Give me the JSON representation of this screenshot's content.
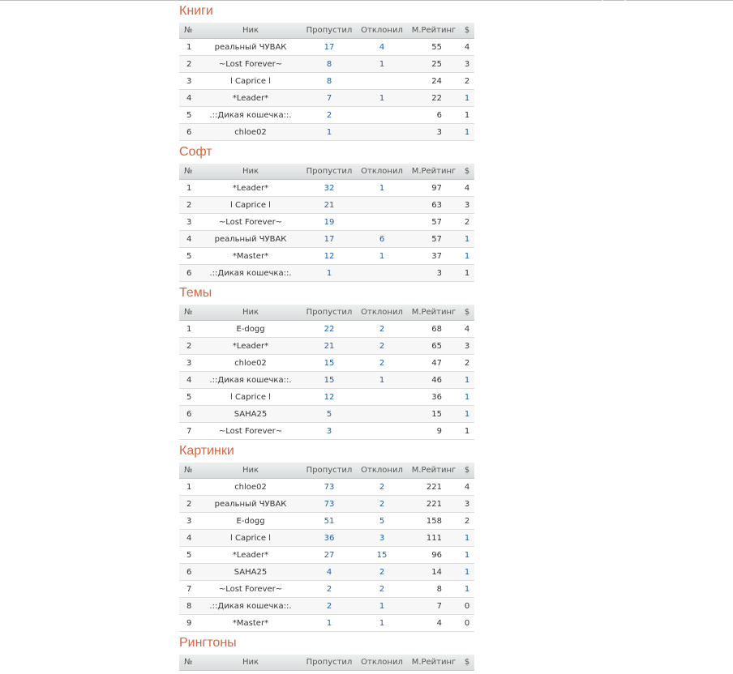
{
  "headers": {
    "num": "№",
    "nick": "Ник",
    "skipped": "Пропустил",
    "rejected": "Отклонил",
    "rating": "М.Рейтинг",
    "cash": "$"
  },
  "sections": [
    {
      "title": "Книги",
      "rows": [
        {
          "num": "1",
          "nick": "реальный ЧУВАК",
          "skipped": "17",
          "rejected": "4",
          "rating": "55",
          "cash": "4",
          "cash_link": false
        },
        {
          "num": "2",
          "nick": "~Lost Forever~",
          "skipped": "8",
          "rejected": "1",
          "rating": "25",
          "cash": "3",
          "cash_link": false
        },
        {
          "num": "3",
          "nick": "l Caprice l",
          "skipped": "8",
          "rejected": "",
          "rating": "24",
          "cash": "2",
          "cash_link": false
        },
        {
          "num": "4",
          "nick": "*Leader*",
          "skipped": "7",
          "rejected": "1",
          "rating": "22",
          "cash": "1",
          "cash_link": true
        },
        {
          "num": "5",
          "nick": ".::Дикая кошечка::.",
          "skipped": "2",
          "rejected": "",
          "rating": "6",
          "cash": "1",
          "cash_link": false
        },
        {
          "num": "6",
          "nick": "chloe02",
          "skipped": "1",
          "rejected": "",
          "rating": "3",
          "cash": "1",
          "cash_link": true
        }
      ]
    },
    {
      "title": "Софт",
      "rows": [
        {
          "num": "1",
          "nick": "*Leader*",
          "skipped": "32",
          "rejected": "1",
          "rating": "97",
          "cash": "4",
          "cash_link": false
        },
        {
          "num": "2",
          "nick": "l Caprice l",
          "skipped": "21",
          "rejected": "",
          "rating": "63",
          "cash": "3",
          "cash_link": false
        },
        {
          "num": "3",
          "nick": "~Lost Forever~",
          "skipped": "19",
          "rejected": "",
          "rating": "57",
          "cash": "2",
          "cash_link": false
        },
        {
          "num": "4",
          "nick": "реальный ЧУВАК",
          "skipped": "17",
          "rejected": "6",
          "rating": "57",
          "cash": "1",
          "cash_link": true
        },
        {
          "num": "5",
          "nick": "*Master*",
          "skipped": "12",
          "rejected": "1",
          "rating": "37",
          "cash": "1",
          "cash_link": true
        },
        {
          "num": "6",
          "nick": ".::Дикая кошечка::.",
          "skipped": "1",
          "rejected": "",
          "rating": "3",
          "cash": "1",
          "cash_link": false
        }
      ]
    },
    {
      "title": "Темы",
      "rows": [
        {
          "num": "1",
          "nick": "E-dogg",
          "skipped": "22",
          "rejected": "2",
          "rating": "68",
          "cash": "4",
          "cash_link": false
        },
        {
          "num": "2",
          "nick": "*Leader*",
          "skipped": "21",
          "rejected": "2",
          "rating": "65",
          "cash": "3",
          "cash_link": false
        },
        {
          "num": "3",
          "nick": "chloe02",
          "skipped": "15",
          "rejected": "2",
          "rating": "47",
          "cash": "2",
          "cash_link": false
        },
        {
          "num": "4",
          "nick": ".::Дикая кошечка::.",
          "skipped": "15",
          "rejected": "1",
          "rating": "46",
          "cash": "1",
          "cash_link": true
        },
        {
          "num": "5",
          "nick": "l Caprice l",
          "skipped": "12",
          "rejected": "",
          "rating": "36",
          "cash": "1",
          "cash_link": true
        },
        {
          "num": "6",
          "nick": "SAHA25",
          "skipped": "5",
          "rejected": "",
          "rating": "15",
          "cash": "1",
          "cash_link": true
        },
        {
          "num": "7",
          "nick": "~Lost Forever~",
          "skipped": "3",
          "rejected": "",
          "rating": "9",
          "cash": "1",
          "cash_link": false
        }
      ]
    },
    {
      "title": "Картинки",
      "rows": [
        {
          "num": "1",
          "nick": "chloe02",
          "skipped": "73",
          "rejected": "2",
          "rating": "221",
          "cash": "4",
          "cash_link": false
        },
        {
          "num": "2",
          "nick": "реальный ЧУВАК",
          "skipped": "73",
          "rejected": "2",
          "rating": "221",
          "cash": "3",
          "cash_link": false
        },
        {
          "num": "3",
          "nick": "E-dogg",
          "skipped": "51",
          "rejected": "5",
          "rating": "158",
          "cash": "2",
          "cash_link": false
        },
        {
          "num": "4",
          "nick": "l Caprice l",
          "skipped": "36",
          "rejected": "3",
          "rating": "111",
          "cash": "1",
          "cash_link": true
        },
        {
          "num": "5",
          "nick": "*Leader*",
          "skipped": "27",
          "rejected": "15",
          "rating": "96",
          "cash": "1",
          "cash_link": true
        },
        {
          "num": "6",
          "nick": "SAHA25",
          "skipped": "4",
          "rejected": "2",
          "rating": "14",
          "cash": "1",
          "cash_link": true
        },
        {
          "num": "7",
          "nick": "~Lost Forever~",
          "skipped": "2",
          "rejected": "2",
          "rating": "8",
          "cash": "1",
          "cash_link": true
        },
        {
          "num": "8",
          "nick": ".::Дикая кошечка::.",
          "skipped": "2",
          "rejected": "1",
          "rating": "7",
          "cash": "0",
          "cash_link": false
        },
        {
          "num": "9",
          "nick": "*Master*",
          "skipped": "1",
          "rejected": "1",
          "rating": "4",
          "cash": "0",
          "cash_link": false
        }
      ]
    },
    {
      "title": "Рингтоны",
      "rows": []
    }
  ],
  "colors": {
    "section_title": "#d9653f",
    "link": "#1d5fb0",
    "text": "#333333"
  }
}
